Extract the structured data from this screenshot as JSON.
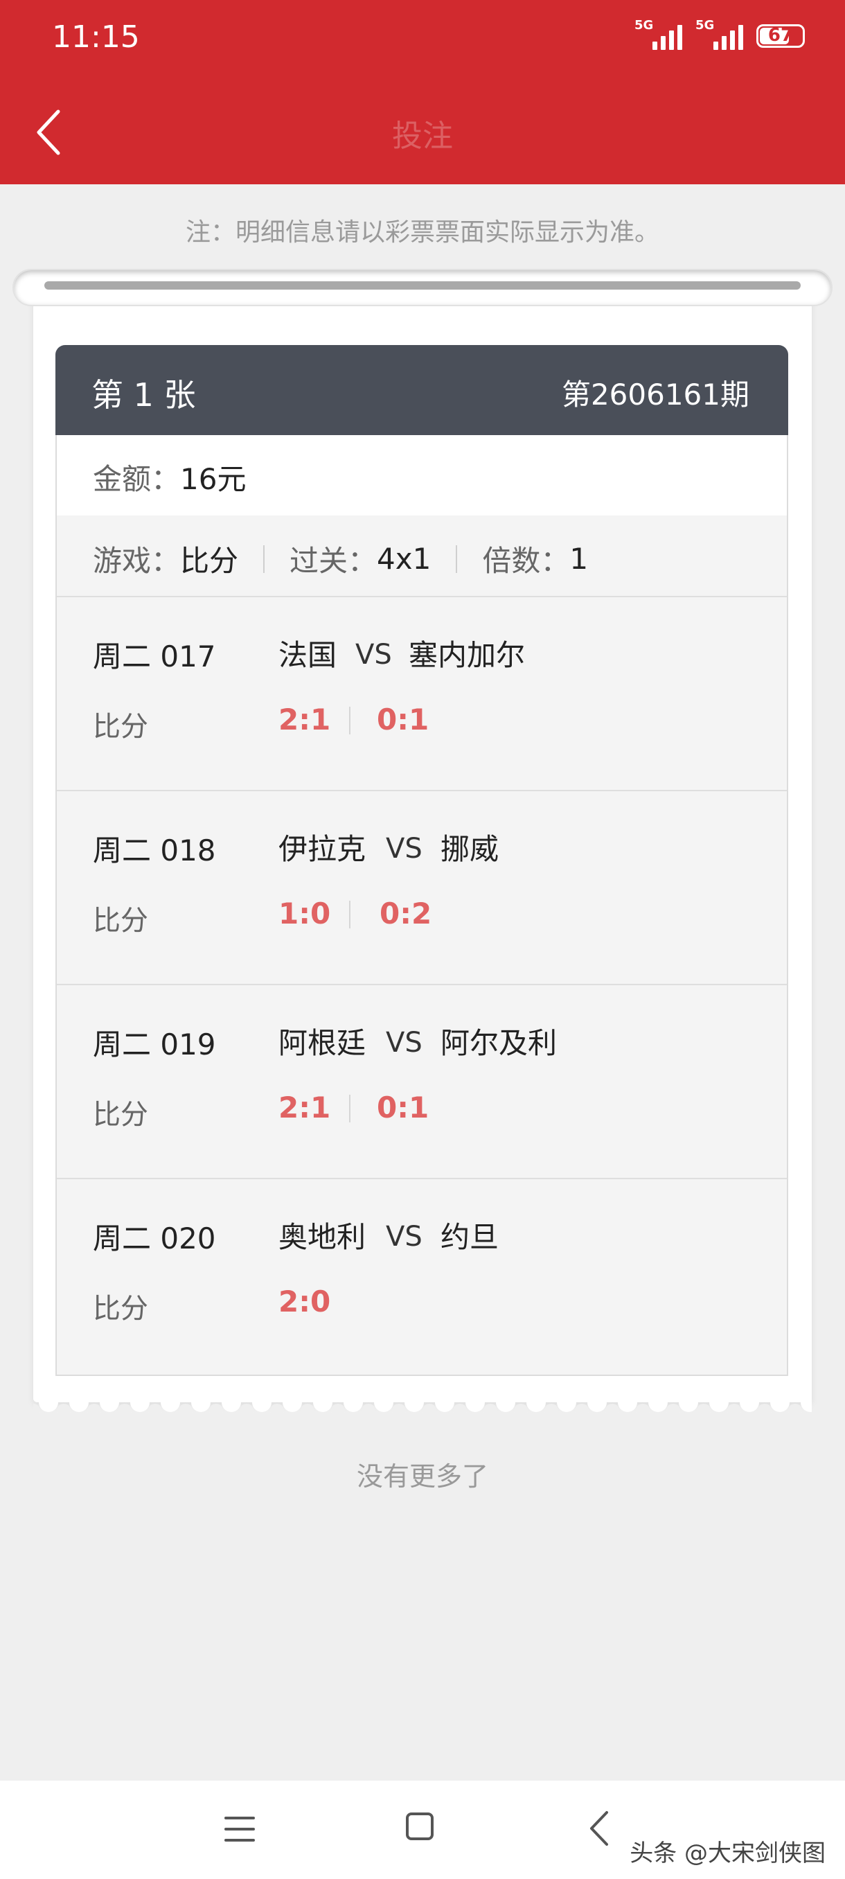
{
  "status_bar": {
    "time": "11:15",
    "network1": "5G",
    "network2": "5G",
    "battery": "67"
  },
  "header": {
    "title": "投注"
  },
  "note": "注：明细信息请以彩票票面实际显示为准。",
  "ticket": {
    "number_label": "第 1 张",
    "period": "第2606161期",
    "amount_key": "金额：",
    "amount_value": "16元",
    "game_key": "游戏：",
    "game_value": "比分",
    "pass_key": "过关：",
    "pass_value": "4x1",
    "multiple_key": "倍数：",
    "multiple_value": "1",
    "matches": [
      {
        "week": "周二 017",
        "home": "法国",
        "vs": "VS",
        "away": "塞内加尔",
        "type": "比分",
        "scores": [
          "2:1",
          "0:1"
        ]
      },
      {
        "week": "周二 018",
        "home": "伊拉克",
        "vs": "VS",
        "away": "挪威",
        "type": "比分",
        "scores": [
          "1:0",
          "0:2"
        ]
      },
      {
        "week": "周二 019",
        "home": "阿根廷",
        "vs": "VS",
        "away": "阿尔及利",
        "type": "比分",
        "scores": [
          "2:1",
          "0:1"
        ]
      },
      {
        "week": "周二 020",
        "home": "奥地利",
        "vs": "VS",
        "away": "约旦",
        "type": "比分",
        "scores": [
          "2:0"
        ]
      }
    ]
  },
  "footer": {
    "no_more": "没有更多了"
  },
  "watermark": "头条 @大宋剑侠图",
  "colors": {
    "header_red": "#d12a2f",
    "ticket_head": "#4a4f59",
    "score_red": "#e06262"
  }
}
